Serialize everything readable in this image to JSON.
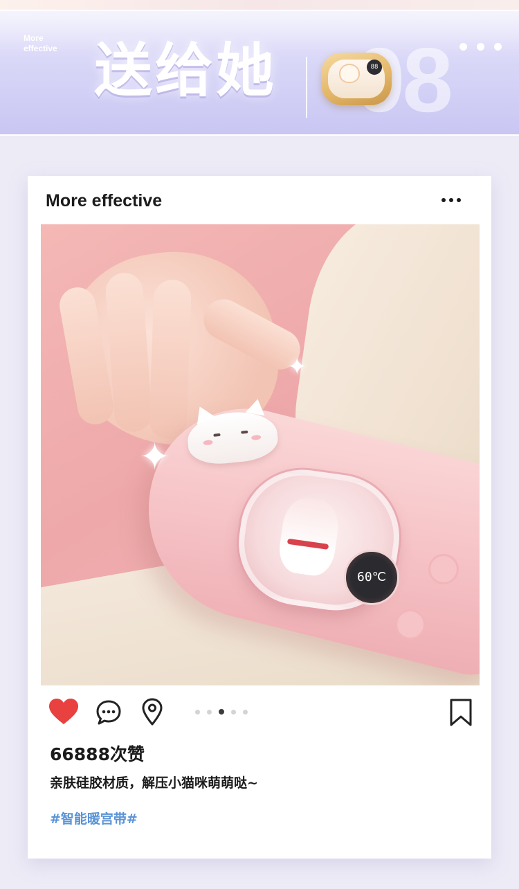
{
  "banner": {
    "subtitle": "More effective",
    "title": "送给她",
    "number": "08",
    "mini_display": "88"
  },
  "card": {
    "header_title": "More effective",
    "photo": {
      "display_value": "60℃"
    },
    "actions": {
      "liked": true,
      "pager_count": 5,
      "pager_active_index": 2
    },
    "likes": "66888次赞",
    "caption": "亲肤硅胶材质，解压小猫咪萌萌哒~",
    "hashtag": "#智能暖宫带#"
  },
  "colors": {
    "like_red": "#e8413f",
    "hashtag_blue": "#5b93d6",
    "banner_lavender": "#d8d6f7"
  }
}
